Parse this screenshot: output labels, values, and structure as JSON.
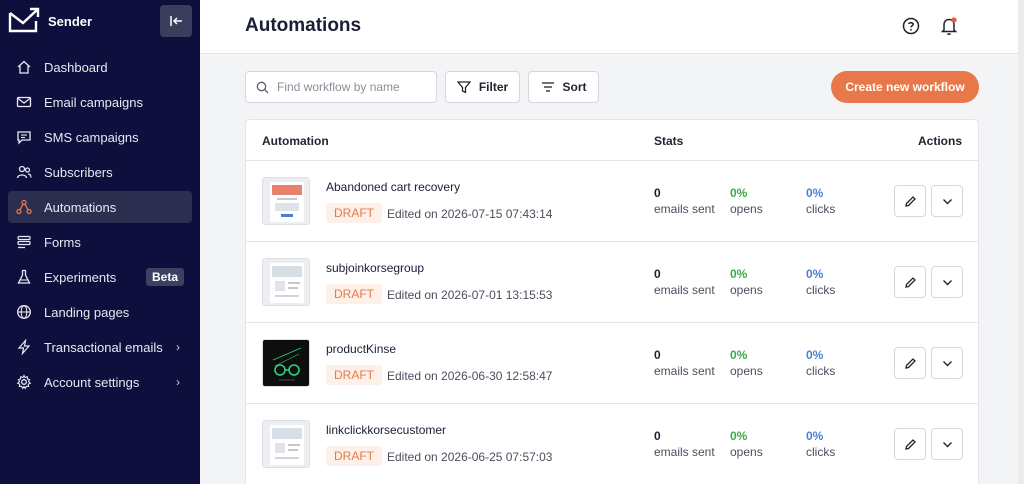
{
  "app": {
    "name": "Sender"
  },
  "sidebar": {
    "items": [
      {
        "label": "Dashboard",
        "icon": "home-icon"
      },
      {
        "label": "Email campaigns",
        "icon": "envelope-icon"
      },
      {
        "label": "SMS campaigns",
        "icon": "chat-icon"
      },
      {
        "label": "Subscribers",
        "icon": "users-icon"
      },
      {
        "label": "Automations",
        "icon": "workflow-icon",
        "active": true
      },
      {
        "label": "Forms",
        "icon": "forms-icon"
      },
      {
        "label": "Experiments",
        "icon": "flask-icon",
        "badge": "Beta"
      },
      {
        "label": "Landing pages",
        "icon": "globe-icon"
      },
      {
        "label": "Transactional emails",
        "icon": "lightning-icon",
        "chevron": "›"
      },
      {
        "label": "Account settings",
        "icon": "gear-icon",
        "chevron": "›"
      }
    ]
  },
  "header": {
    "title": "Automations"
  },
  "toolbar": {
    "search_placeholder": "Find workflow by name",
    "filter_label": "Filter",
    "sort_label": "Sort",
    "create_label": "Create new workflow"
  },
  "table": {
    "headers": {
      "automation": "Automation",
      "stats": "Stats",
      "actions": "Actions"
    },
    "rows": [
      {
        "name": "Abandoned cart recovery",
        "status": "DRAFT",
        "edited": "Edited on 2026-07-15 07:43:14",
        "sent": "0",
        "sent_label": "emails sent",
        "opens": "0%",
        "opens_label": "opens",
        "clicks": "0%",
        "clicks_label": "clicks"
      },
      {
        "name": "subjoinkorsegroup",
        "status": "DRAFT",
        "edited": "Edited on 2026-07-01 13:15:53",
        "sent": "0",
        "sent_label": "emails sent",
        "opens": "0%",
        "opens_label": "opens",
        "clicks": "0%",
        "clicks_label": "clicks"
      },
      {
        "name": "productKinse",
        "status": "DRAFT",
        "edited": "Edited on 2026-06-30 12:58:47",
        "sent": "0",
        "sent_label": "emails sent",
        "opens": "0%",
        "opens_label": "opens",
        "clicks": "0%",
        "clicks_label": "clicks"
      },
      {
        "name": "linkclickkorsecustomer",
        "status": "DRAFT",
        "edited": "Edited on 2026-06-25 07:57:03",
        "sent": "0",
        "sent_label": "emails sent",
        "opens": "0%",
        "opens_label": "opens",
        "clicks": "0%",
        "clicks_label": "clicks"
      }
    ]
  },
  "colors": {
    "sidebar_bg": "#0f0f3d",
    "accent": "#e8784a",
    "opens": "#3ca94b",
    "clicks": "#4a7fd4"
  }
}
